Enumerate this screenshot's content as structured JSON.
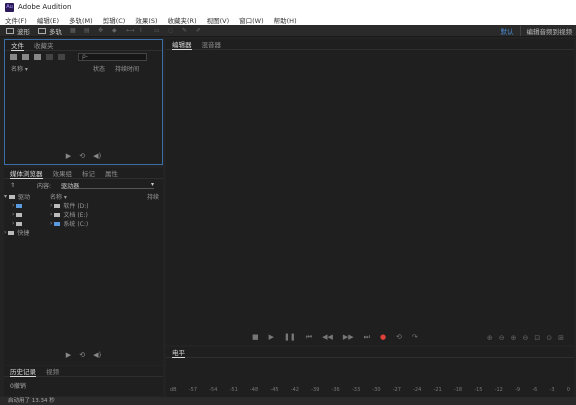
{
  "window": {
    "title": "Adobe Audition",
    "logo_text": "Au"
  },
  "menu": [
    "文件(F)",
    "编辑(E)",
    "多轨(M)",
    "剪辑(C)",
    "效果(S)",
    "收藏夹(R)",
    "视图(V)",
    "窗口(W)",
    "帮助(H)"
  ],
  "toolbar": {
    "waveform_label": "波形",
    "multitrack_label": "多轨",
    "workspace": "默认",
    "workspace_edit": "编辑音频到视频"
  },
  "files_panel": {
    "tabs": [
      "文件",
      "收藏夹"
    ],
    "search_placeholder": "ρ-",
    "columns": [
      "名称 ▾",
      "状态",
      "持续时间"
    ]
  },
  "media_panel": {
    "tabs": [
      "媒体浏览器",
      "效果组",
      "标记",
      "属性"
    ],
    "contents_label": "内容:",
    "contents_value": "驱动器",
    "left_tree": [
      "驱动",
      "",
      "",
      "快捷"
    ],
    "name_header": "名称 ▾",
    "duration_header": "持续",
    "drives": [
      "软件 (D:)",
      "文档 (E:)",
      "系统 (C:)"
    ]
  },
  "history_panel": {
    "tabs": [
      "历史记录",
      "视频"
    ],
    "undo_label": "0撤销"
  },
  "editor_panel": {
    "tabs": [
      "编辑器",
      "混音器"
    ]
  },
  "levels_panel": {
    "tab": "电平",
    "ruler": [
      "dB",
      "-57",
      "-54",
      "-51",
      "-48",
      "-45",
      "-42",
      "-39",
      "-36",
      "-33",
      "-30",
      "-27",
      "-24",
      "-21",
      "-18",
      "-15",
      "-12",
      "-9",
      "-6",
      "-3",
      "0"
    ]
  },
  "status": {
    "text": "启动用了 13.34 秒"
  },
  "colors": {
    "accent": "#3a6fa8",
    "record": "#e0403a",
    "workspace": "#4a8fd8"
  }
}
